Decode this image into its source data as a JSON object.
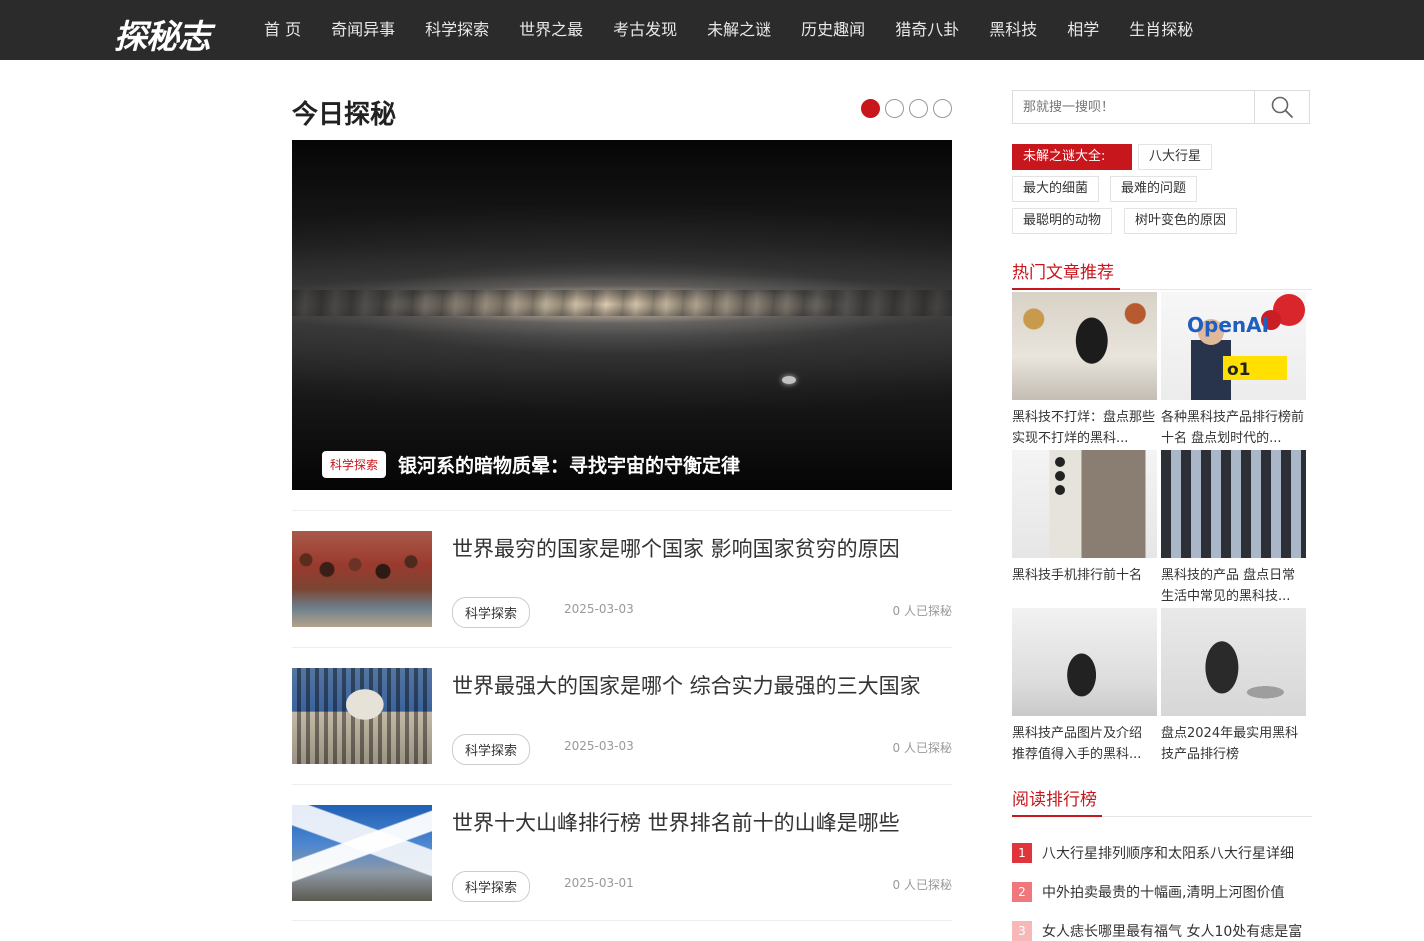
{
  "header": {
    "logo": "探秘志",
    "nav": [
      "首 页",
      "奇闻异事",
      "科学探索",
      "世界之最",
      "考古发现",
      "未解之谜",
      "历史趣闻",
      "猎奇八卦",
      "黑科技",
      "相学",
      "生肖探秘"
    ]
  },
  "featured": {
    "section_title": "今日探秘",
    "slide_count": 4,
    "active_slide": 1,
    "hero_tag": "科学探索",
    "hero_title": "银河系的暗物质晕：寻找宇宙的守衡定律"
  },
  "articles": [
    {
      "title": "世界最穷的国家是哪个国家 影响国家贫穷的原因",
      "tag": "科学探索",
      "date": "2025-03-03",
      "views": "0 人已探秘",
      "image": "crowd-photo"
    },
    {
      "title": "世界最强大的国家是哪个 综合实力最强的三大国家",
      "tag": "科学探索",
      "date": "2025-03-03",
      "views": "0 人已探秘",
      "image": "capitol-photo"
    },
    {
      "title": "世界十大山峰排行榜 世界排名前十的山峰是哪些",
      "tag": "科学探索",
      "date": "2025-03-01",
      "views": "0 人已探秘",
      "image": "mountain-photo"
    }
  ],
  "sidebar": {
    "search": {
      "placeholder": "那就搜一搜呗！"
    },
    "tagcloud": {
      "label": "未解之谜大全:",
      "tags": [
        "八大行星",
        "最大的细菌",
        "最难的问题",
        "最聪明的动物",
        "树叶变色的原因"
      ]
    },
    "hot": {
      "heading": "热门文章推荐",
      "items": [
        {
          "title": "黑科技不打烊：盘点那些实现不打烊的黑科...",
          "image": "phone-photo"
        },
        {
          "title": "各种黑科技产品排行榜前十名 盘点划时代的...",
          "image": "openai-photo"
        },
        {
          "title": "黑科技手机排行前十名",
          "image": "samsung-photo"
        },
        {
          "title": "黑科技的产品 盘点日常生活中常见的黑科技...",
          "image": "gadgets-photo"
        },
        {
          "title": "黑科技产品图片及介绍 推荐值得入手的黑科...",
          "image": "speaker-photo"
        },
        {
          "title": "盘点2024年最实用黑科技产品排行榜",
          "image": "speaker2-photo"
        }
      ]
    },
    "ranking": {
      "heading": "阅读排行榜",
      "items": [
        {
          "num": "1",
          "title": "八大行星排列顺序和太阳系八大行星详细"
        },
        {
          "num": "2",
          "title": "中外拍卖最贵的十幅画,清明上河图价值"
        },
        {
          "num": "3",
          "title": "女人痣长哪里最有福气 女人10处有痣是富"
        }
      ]
    }
  },
  "colors": {
    "accent": "#c8161d",
    "header_bg": "#2b2b2b",
    "rank_1": "#e0353b",
    "rank_2": "#f0787c",
    "rank_3": "#f7b8ba"
  }
}
